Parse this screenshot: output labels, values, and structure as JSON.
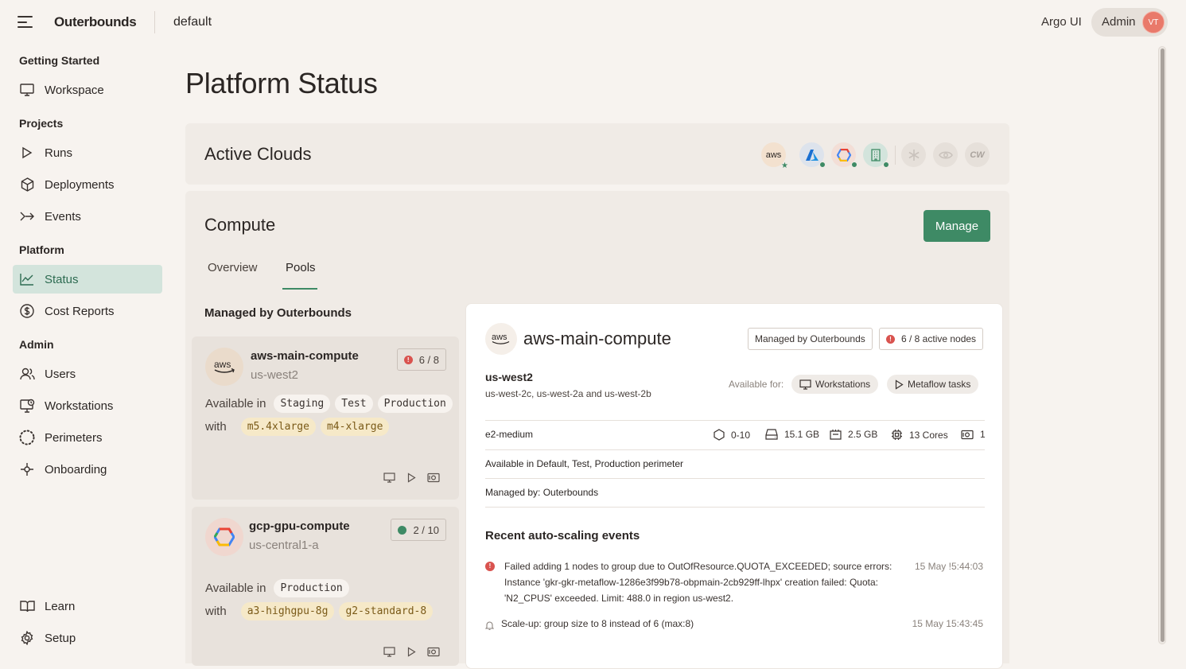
{
  "header": {
    "brand": "Outerbounds",
    "project": "default",
    "argo_link": "Argo UI",
    "user_label": "Admin",
    "avatar_initials": "VT"
  },
  "sidebar": {
    "sections": [
      {
        "title": "Getting Started",
        "items": [
          {
            "label": "Workspace",
            "icon": "monitor-icon"
          }
        ]
      },
      {
        "title": "Projects",
        "items": [
          {
            "label": "Runs",
            "icon": "play-icon"
          },
          {
            "label": "Deployments",
            "icon": "package-icon"
          },
          {
            "label": "Events",
            "icon": "event-arrow-icon"
          }
        ]
      },
      {
        "title": "Platform",
        "items": [
          {
            "label": "Status",
            "icon": "chart-line-icon",
            "active": true
          },
          {
            "label": "Cost Reports",
            "icon": "dollar-icon"
          }
        ]
      },
      {
        "title": "Admin",
        "items": [
          {
            "label": "Users",
            "icon": "users-icon"
          },
          {
            "label": "Workstations",
            "icon": "workstation-icon"
          },
          {
            "label": "Perimeters",
            "icon": "dotted-circle-icon"
          },
          {
            "label": "Onboarding",
            "icon": "onboarding-icon"
          }
        ]
      }
    ],
    "footer": [
      {
        "label": "Learn",
        "icon": "book-icon"
      },
      {
        "label": "Setup",
        "icon": "gear-icon"
      }
    ]
  },
  "page": {
    "title": "Platform Status"
  },
  "clouds": {
    "title": "Active Clouds",
    "providers": [
      {
        "name": "aws",
        "label": "aws",
        "active": true
      },
      {
        "name": "azure",
        "label": "A",
        "active": true
      },
      {
        "name": "gcp",
        "label": "",
        "active": true
      },
      {
        "name": "on-prem",
        "label": "",
        "active": true
      },
      {
        "name": "snowflake",
        "label": "",
        "active": false
      },
      {
        "name": "nvidia",
        "label": "",
        "active": false
      },
      {
        "name": "coreweave",
        "label": "CW",
        "active": false
      }
    ]
  },
  "compute": {
    "title": "Compute",
    "manage_label": "Manage",
    "tabs": [
      "Overview",
      "Pools"
    ],
    "selected_tab": "Pools",
    "managed_heading": "Managed by Outerbounds",
    "available_in_label": "Available in",
    "with_label": "with",
    "pools": [
      {
        "name": "aws-main-compute",
        "region": "us-west2",
        "badge": "6 / 8",
        "status": "error",
        "available_in": [
          "Staging",
          "Test",
          "Production"
        ],
        "instances": [
          "m5.4xlarge",
          "m4-xlarge"
        ]
      },
      {
        "name": "gcp-gpu-compute",
        "region": "us-central1-a",
        "badge": "2 / 10",
        "status": "ok",
        "available_in": [
          "Production"
        ],
        "instances": [
          "a3-highgpu-8g",
          "g2-standard-8"
        ]
      }
    ]
  },
  "detail": {
    "name": "aws-main-compute",
    "logo": "aws",
    "managed_badge": "Managed by Outerbounds",
    "nodes_badge": "6 / 8 active nodes",
    "region": "us-west2",
    "zones": "us-west-2c, us-west-2a and us-west-2b",
    "available_for_label": "Available for:",
    "available_for": [
      "Workstations",
      "Metaflow tasks"
    ],
    "instance_type": "e2-medium",
    "specs": {
      "nodes": "0-10",
      "disk": "15.1 GB",
      "memory": "2.5 GB",
      "cpu": "13 Cores",
      "gpu": "1"
    },
    "perimeter_line": "Available in Default, Test, Production perimeter",
    "managed_by_line": "Managed by: Outerbounds",
    "events_heading": "Recent auto-scaling events",
    "events": [
      {
        "type": "error",
        "text_l1": "Failed adding 1 nodes to group due to OutOfResource.QUOTA_EXCEEDED; source errors:",
        "text_l2": "Instance 'gkr-gkr-metaflow-1286e3f99b78-obpmain-2cb929ff-lhpx' creation failed: Quota:",
        "text_l3": "'N2_CPUS' exceeded. Limit: 488.0 in region us-west2.",
        "time": "15 May !5:44:03"
      },
      {
        "type": "info",
        "text_l1": "Scale-up: group size to 8 instead of 6 (max:8)",
        "time": "15 May 15:43:45"
      }
    ]
  },
  "colors": {
    "accent": "#3e8a65",
    "active_nav_bg": "#d3e4dc",
    "error": "#d9534f",
    "background": "#f7f3ef"
  }
}
